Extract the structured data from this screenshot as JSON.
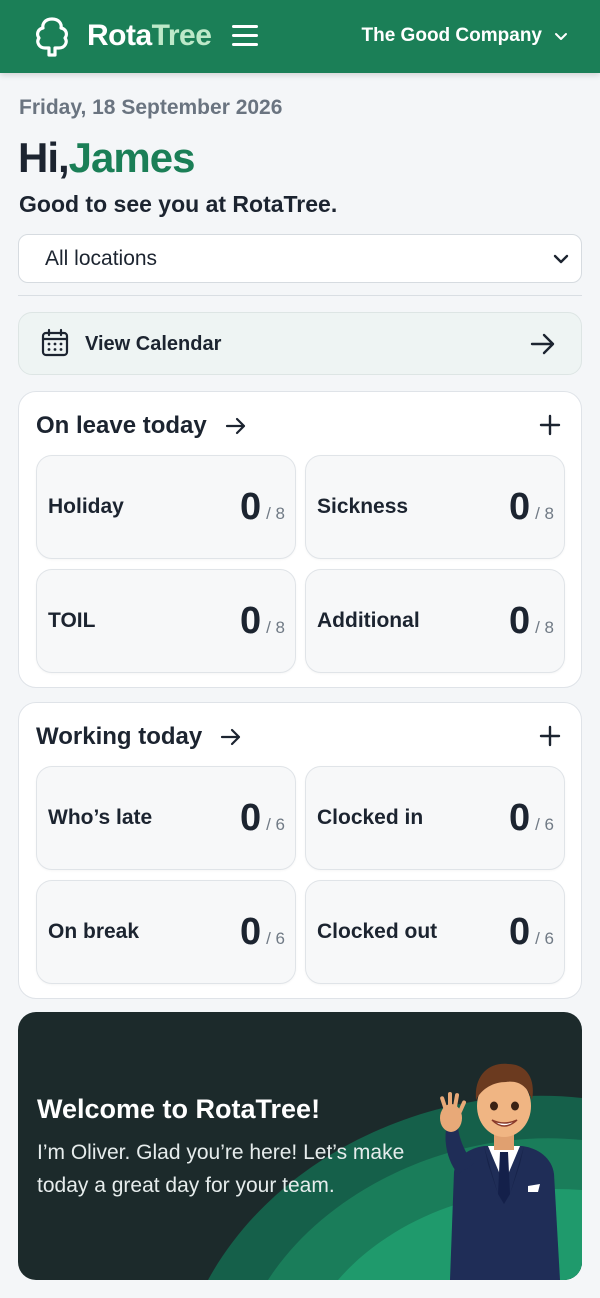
{
  "header": {
    "brand_part1": "Rota",
    "brand_part2": "Tree",
    "company": "The Good Company"
  },
  "greeting": {
    "date": "Friday, 18 September 2026",
    "hi": "Hi,",
    "name": "James",
    "subtitle": "Good to see you at RotaTree."
  },
  "location_select": {
    "value": "All locations"
  },
  "calendar": {
    "label": "View Calendar"
  },
  "on_leave": {
    "title": "On leave today",
    "tiles": [
      {
        "label": "Holiday",
        "value": "0",
        "total": "/ 8"
      },
      {
        "label": "Sickness",
        "value": "0",
        "total": "/ 8"
      },
      {
        "label": "TOIL",
        "value": "0",
        "total": "/ 8"
      },
      {
        "label": "Additional",
        "value": "0",
        "total": "/ 8"
      }
    ]
  },
  "working": {
    "title": "Working today",
    "tiles": [
      {
        "label": "Who’s late",
        "value": "0",
        "total": "/ 6"
      },
      {
        "label": "Clocked in",
        "value": "0",
        "total": "/ 6"
      },
      {
        "label": "On break",
        "value": "0",
        "total": "/ 6"
      },
      {
        "label": "Clocked out",
        "value": "0",
        "total": "/ 6"
      }
    ]
  },
  "welcome": {
    "title": "Welcome to RotaTree!",
    "text": "I’m Oliver. Glad you’re here! Let’s make today a great day for your team."
  },
  "icons": {
    "logo": "tree-icon",
    "menu": "hamburger-menu-icon",
    "company_chevron": "chevron-down-icon",
    "select_chevron": "chevron-down-icon",
    "calendar": "calendar-icon",
    "arrow": "arrow-right-icon",
    "add": "plus-icon"
  },
  "colors": {
    "brand_green": "#1b7f57",
    "dark_card": "#1c2a2b",
    "background": "#f4f6f8"
  }
}
